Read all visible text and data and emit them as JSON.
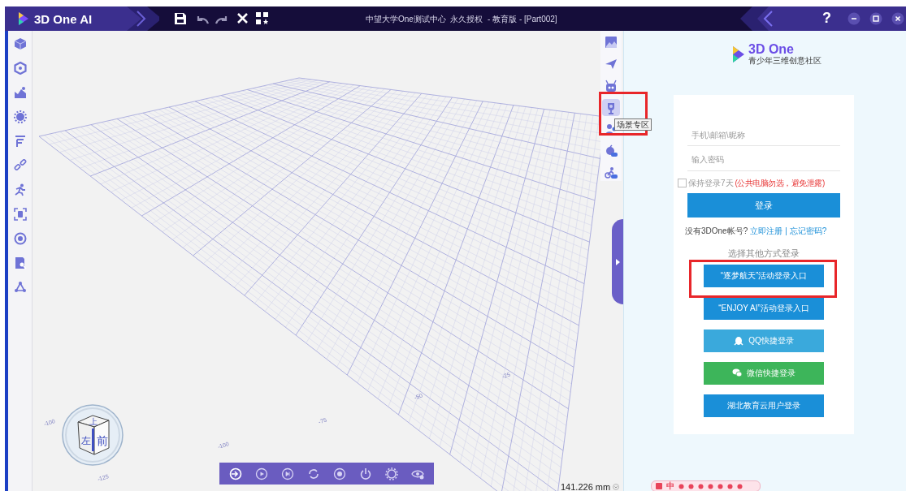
{
  "window": {
    "app_name": "3D One AI",
    "title": "中望大学One测试中心  永久授权  - 教育版 - [Part002]",
    "help": "?"
  },
  "scene_tools": [
    {
      "selected": false
    },
    {
      "selected": false
    },
    {
      "selected": false
    },
    {
      "selected": true
    },
    {
      "selected": false
    },
    {
      "selected": false
    },
    {
      "selected": false
    }
  ],
  "scene_tooltip": "场景专区",
  "grid_labels": [
    "-100",
    "-125",
    "-100",
    "-75",
    "-50",
    "-25"
  ],
  "view_cube": {
    "top": "上",
    "left": "左",
    "front": "前"
  },
  "measurement": "141.226 mm",
  "login": {
    "brand": "3D One",
    "slogan": "青少年三维创意社区",
    "username_placeholder": "手机\\邮箱\\昵称",
    "password_placeholder": "输入密码",
    "remember": {
      "label": "保持登录7天",
      "warning": "(公共电脑勿选，避免泄露)",
      "checked": false
    },
    "submit": "登录",
    "no_account": "没有3DOne帐号?",
    "register": "立即注册",
    "separator": "|",
    "forgot": "忘记密码?",
    "other_heading": "选择其他方式登录",
    "options": [
      {
        "kind": "event",
        "label": "“逐梦航天”活动登录入口"
      },
      {
        "kind": "event",
        "label": "“ENJOY AI”活动登录入口"
      },
      {
        "kind": "qq",
        "label": "QQ快捷登录"
      },
      {
        "kind": "wechat",
        "label": "微信快捷登录"
      },
      {
        "kind": "event",
        "label": "湖北教育云用户登录"
      }
    ]
  },
  "ime": {
    "mode": "中"
  }
}
